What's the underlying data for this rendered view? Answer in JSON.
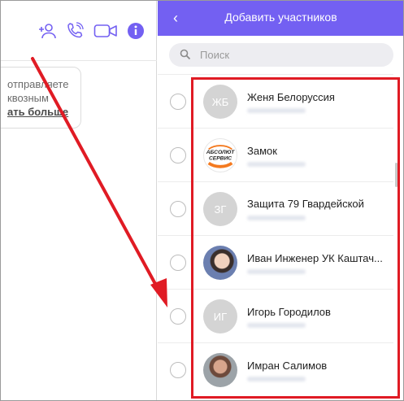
{
  "left_pane": {
    "header_icons": [
      "add-participant-icon",
      "call-icon",
      "video-call-icon",
      "info-icon"
    ],
    "bubble": {
      "line1": "отправляете",
      "line2": "квозным",
      "more": "ать больше"
    }
  },
  "panel": {
    "title": "Добавить участников",
    "back_label": "‹",
    "search_placeholder": "Поиск"
  },
  "contacts": [
    {
      "name": "Женя Белоруссия",
      "initials": "ЖБ"
    },
    {
      "name": "Замок",
      "initials": ""
    },
    {
      "name": "Защита 79 Гвардейской",
      "initials": "ЗГ"
    },
    {
      "name": "Иван Инженер УК Каштач...",
      "initials": ""
    },
    {
      "name": "Игорь Городилов",
      "initials": "ИГ"
    },
    {
      "name": "Имран Салимов",
      "initials": ""
    }
  ],
  "logo_text": {
    "line1": "АБСОЛЮТ",
    "line2": "СЕРВИС"
  },
  "colors": {
    "accent": "#7360f2",
    "annotation": "#e01b24",
    "placeholder_avatar": "#d4d4d4"
  }
}
